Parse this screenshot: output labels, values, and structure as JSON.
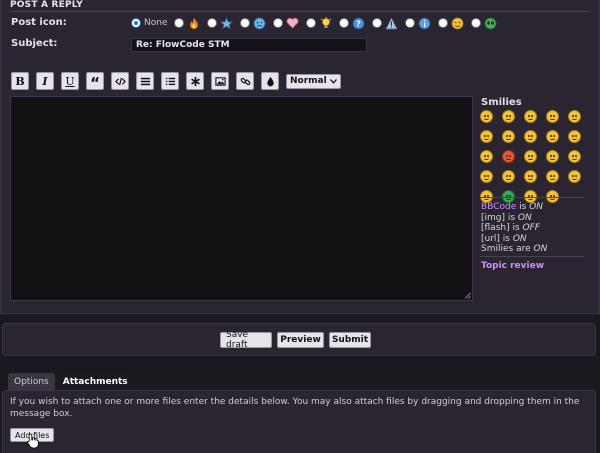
{
  "form": {
    "title": "POST A REPLY",
    "post_icon_label": "Post icon:",
    "none_label": "None",
    "subject_label": "Subject:",
    "subject_value": "Re: FlowCode STM"
  },
  "post_icons": [
    "fire-icon",
    "star-icon",
    "sad-face-icon",
    "heart-icon",
    "lightbulb-icon",
    "question-icon",
    "warning-icon",
    "info-icon",
    "wink-icon",
    "alien-icon"
  ],
  "toolbar": {
    "bold": "B",
    "italic": "I",
    "underline": "U",
    "quote": "“",
    "font_size_selected": "Normal"
  },
  "sidebar": {
    "smilies_title": "Smilies",
    "bbcode_link": "BBCode",
    "bbcode_is": " is ",
    "bbcode_state": "ON",
    "img_label": "[img] is ",
    "img_state": "ON",
    "flash_label": "[flash] is ",
    "flash_state": "OFF",
    "url_label": "[url] is ",
    "url_state": "ON",
    "smilies_label": "Smilies are ",
    "smilies_state": "ON",
    "topic_review": "Topic review"
  },
  "buttons": {
    "save_draft": "Save draft",
    "preview": "Preview",
    "submit": "Submit"
  },
  "tabs": {
    "options": "Options",
    "attachments": "Attachments"
  },
  "attachments": {
    "instructions": "If you wish to attach one or more files enter the details below. You may also attach files by dragging and dropping them in the message box.",
    "add_files": "Add files"
  },
  "colors": {
    "link": "#c790ff",
    "panel": "#2a2530",
    "background": "#1b1820"
  }
}
